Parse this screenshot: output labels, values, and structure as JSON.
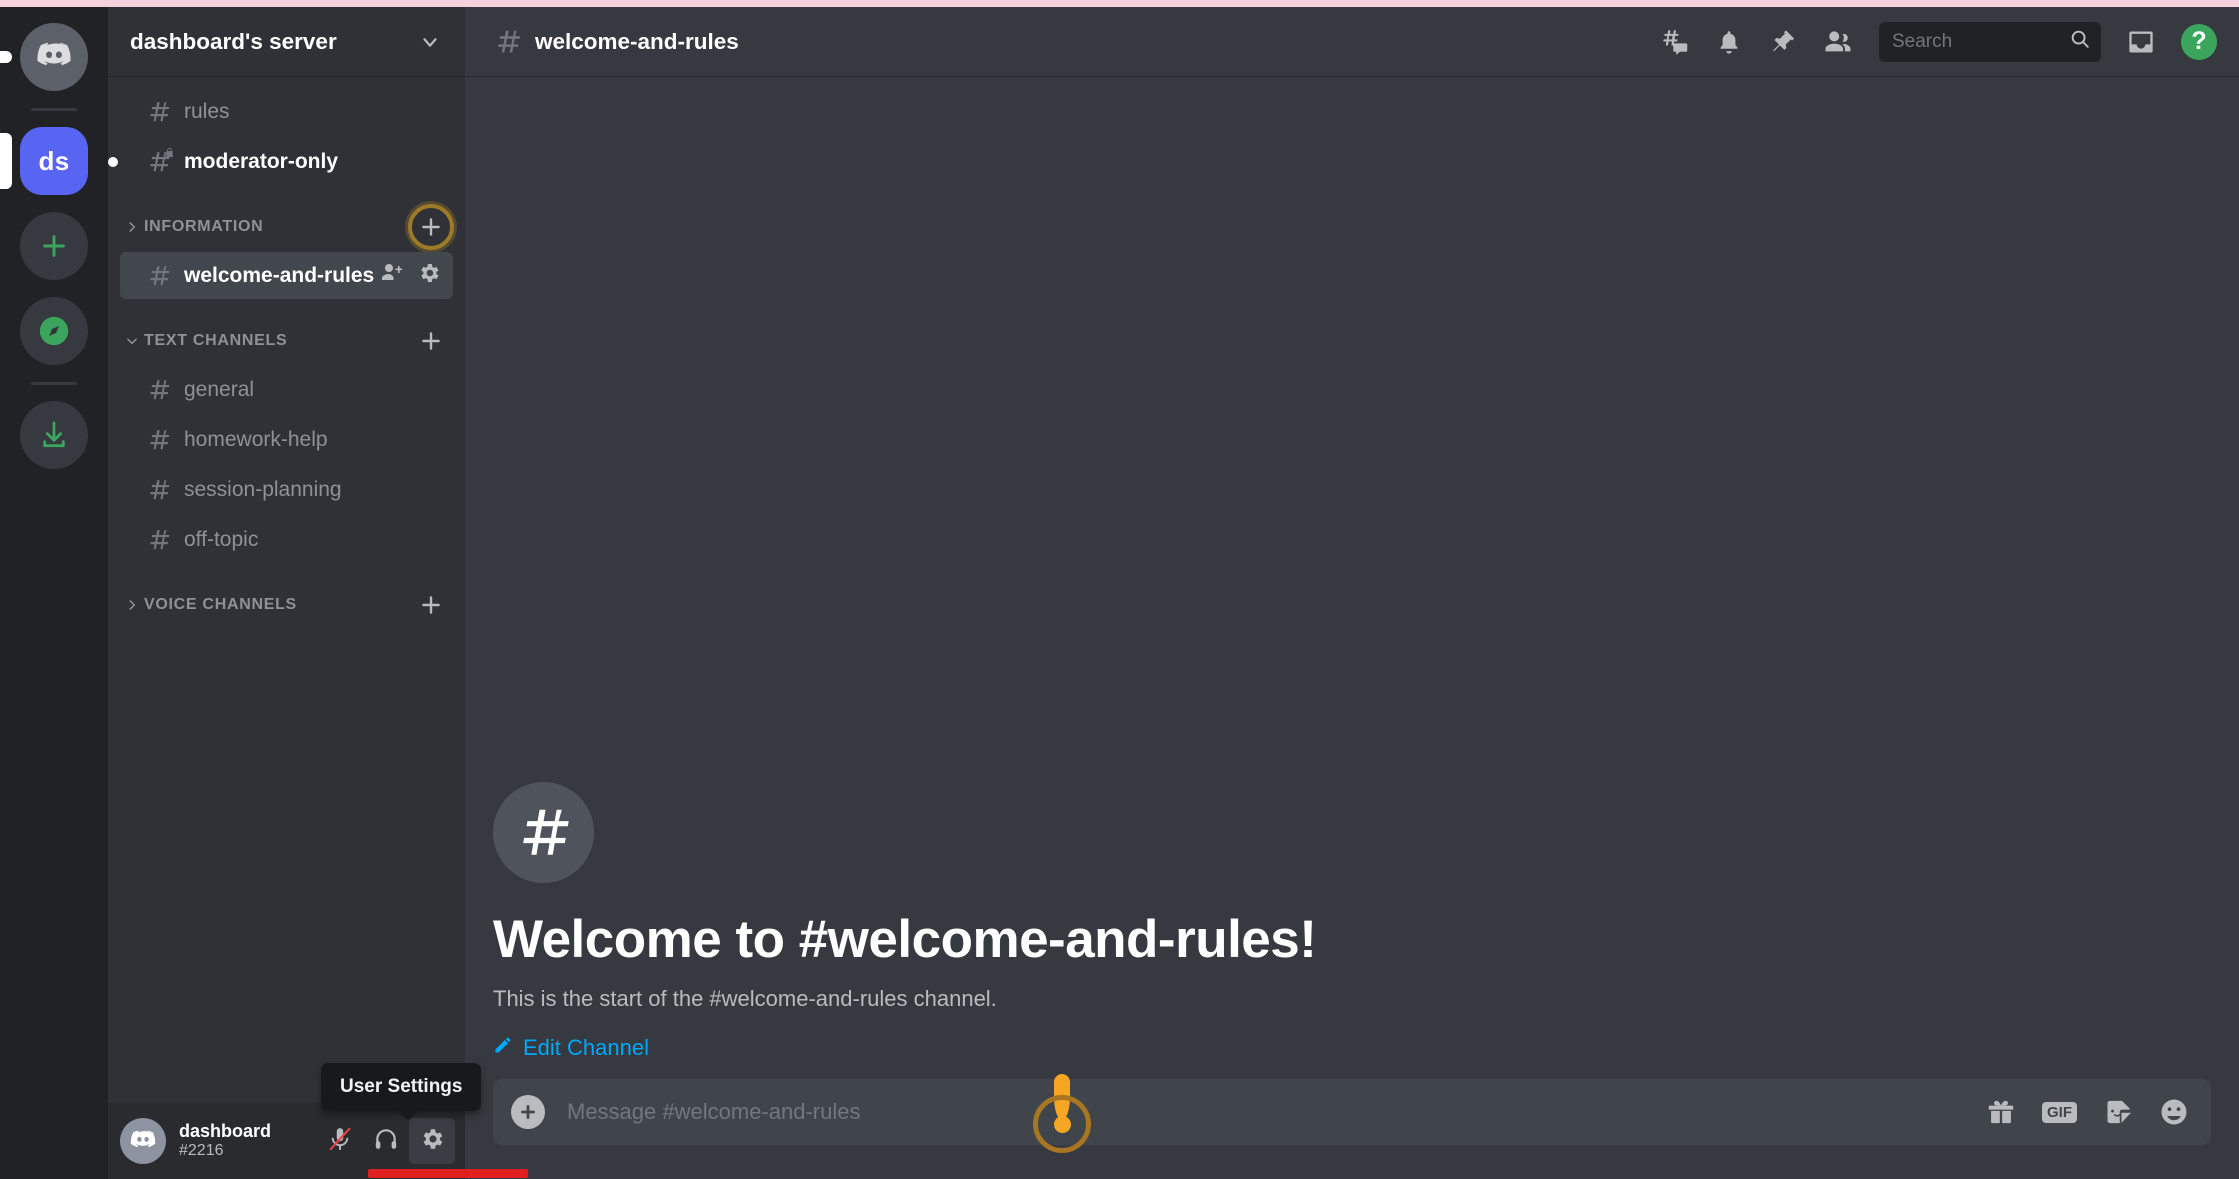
{
  "top_strip_color": "#f6d3dc",
  "accent_color": "#5865f2",
  "server_rail": {
    "items": [
      {
        "name": "home-button",
        "label": "",
        "icon": "discord-logo-icon",
        "state": "idle"
      },
      {
        "name": "server-ds",
        "label": "ds",
        "icon": "server-avatar",
        "state": "active"
      },
      {
        "name": "add-server-button",
        "label": "",
        "icon": "plus-icon",
        "state": "idle"
      },
      {
        "name": "explore-servers-button",
        "label": "",
        "icon": "compass-icon",
        "state": "idle"
      },
      {
        "name": "download-apps-button",
        "label": "",
        "icon": "download-icon",
        "state": "idle"
      }
    ]
  },
  "sidebar": {
    "server_name": "dashboard's server",
    "server_chevron_icon": "chevron-down-icon",
    "top_channels": [
      {
        "name": "rules",
        "icon": "hash-icon",
        "state": "read",
        "private": false
      },
      {
        "name": "moderator-only",
        "icon": "hash-lock-icon",
        "state": "unread",
        "private": true
      }
    ],
    "categories": [
      {
        "label": "INFORMATION",
        "collapsed": true,
        "chevron_icon": "chevron-right-icon",
        "add_icon": "plus-icon",
        "add_highlighted": true,
        "channels": [
          {
            "name": "welcome-and-rules",
            "icon": "hash-icon",
            "state": "selected",
            "actions": [
              "create-invite-icon",
              "edit-channel-gear-icon"
            ]
          }
        ]
      },
      {
        "label": "TEXT CHANNELS",
        "collapsed": false,
        "chevron_icon": "chevron-down-icon",
        "add_icon": "plus-icon",
        "add_highlighted": false,
        "channels": [
          {
            "name": "general",
            "icon": "hash-icon",
            "state": "read"
          },
          {
            "name": "homework-help",
            "icon": "hash-icon",
            "state": "read"
          },
          {
            "name": "session-planning",
            "icon": "hash-icon",
            "state": "read"
          },
          {
            "name": "off-topic",
            "icon": "hash-icon",
            "state": "read"
          }
        ]
      },
      {
        "label": "VOICE CHANNELS",
        "collapsed": true,
        "chevron_icon": "chevron-right-icon",
        "add_icon": "plus-icon",
        "add_highlighted": false,
        "channels": []
      }
    ]
  },
  "user_panel": {
    "username": "dashboard",
    "discriminator": "#2216",
    "avatar_icon": "discord-avatar-icon",
    "mute_icon": "microphone-muted-icon",
    "deafen_icon": "headphones-icon",
    "settings_icon": "gear-icon",
    "settings_active": true,
    "tooltip": "User Settings",
    "underline_color": "#e02020"
  },
  "header": {
    "hash_icon": "hash-icon",
    "channel_title": "welcome-and-rules",
    "tools": [
      {
        "name": "threads-button",
        "icon": "threads-icon"
      },
      {
        "name": "notification-settings-button",
        "icon": "bell-icon"
      },
      {
        "name": "pinned-messages-button",
        "icon": "pin-icon"
      },
      {
        "name": "member-list-button",
        "icon": "members-icon"
      }
    ],
    "search": {
      "placeholder": "Search",
      "value": "",
      "icon": "search-icon"
    },
    "inbox_icon": "inbox-icon",
    "help_label": "?",
    "help_color": "#3ba55d"
  },
  "main": {
    "welcome_hash_icon": "hash-icon",
    "welcome_title": "Welcome to #welcome-and-rules!",
    "welcome_subtitle": "This is the start of the #welcome-and-rules channel.",
    "edit_channel_label": "Edit Channel",
    "edit_channel_icon": "pencil-icon",
    "edit_channel_color": "#00a8fc"
  },
  "composer": {
    "attach_icon": "plus-circle-icon",
    "placeholder": "Message #welcome-and-rules",
    "value": "",
    "tools": [
      {
        "name": "gift-button",
        "icon": "gift-icon",
        "label": ""
      },
      {
        "name": "gif-button",
        "icon": "gif-icon",
        "label": "GIF"
      },
      {
        "name": "sticker-button",
        "icon": "sticker-icon",
        "label": ""
      },
      {
        "name": "emoji-button",
        "icon": "emoji-icon",
        "label": ""
      }
    ]
  },
  "annotations": {
    "click_ring_color": "#9b7b28",
    "cursor_color": "#f5a623"
  }
}
